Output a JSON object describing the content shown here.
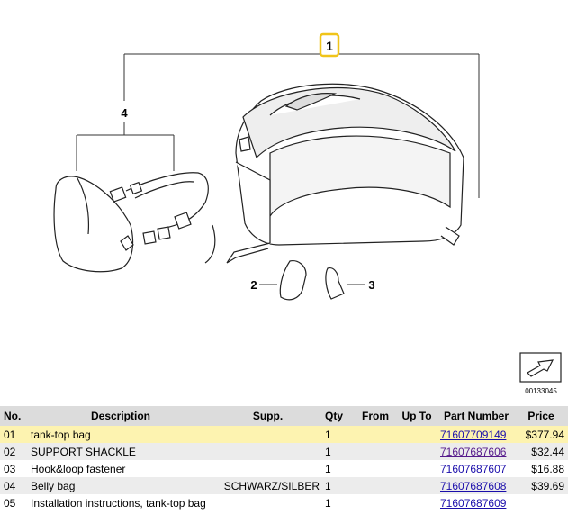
{
  "diagram": {
    "callouts": {
      "c1": "1",
      "c2": "2",
      "c3": "3",
      "c4": "4"
    },
    "image_number": "00133045",
    "colors": {
      "callout_highlight": "#f0c419",
      "line": "#333333"
    }
  },
  "table": {
    "headers": {
      "no": "No.",
      "description": "Description",
      "supp": "Supp.",
      "qty": "Qty",
      "from": "From",
      "upto": "Up To",
      "part_number": "Part Number",
      "price": "Price"
    },
    "rows": [
      {
        "no": "01",
        "description": "tank-top bag",
        "supp": "",
        "qty": "1",
        "from": "",
        "upto": "",
        "part_number": "71607709149",
        "price": "$377.94"
      },
      {
        "no": "02",
        "description": "SUPPORT SHACKLE",
        "supp": "",
        "qty": "1",
        "from": "",
        "upto": "",
        "part_number": "71607687606",
        "price": "$32.44"
      },
      {
        "no": "03",
        "description": "Hook&loop fastener",
        "supp": "",
        "qty": "1",
        "from": "",
        "upto": "",
        "part_number": "71607687607",
        "price": "$16.88"
      },
      {
        "no": "04",
        "description": "Belly bag",
        "supp": "SCHWARZ/SILBER",
        "qty": "1",
        "from": "",
        "upto": "",
        "part_number": "71607687608",
        "price": "$39.69"
      },
      {
        "no": "05",
        "description": "Installation instructions, tank-top bag",
        "supp": "",
        "qty": "1",
        "from": "",
        "upto": "",
        "part_number": "71607687609",
        "price": ""
      }
    ],
    "colors": {
      "header_bg": "#dcdcdc",
      "highlight_bg": "#fdf3b0",
      "alt_bg": "#ececec",
      "link": "#1a0dab",
      "visited_link": "#551a8b"
    }
  }
}
